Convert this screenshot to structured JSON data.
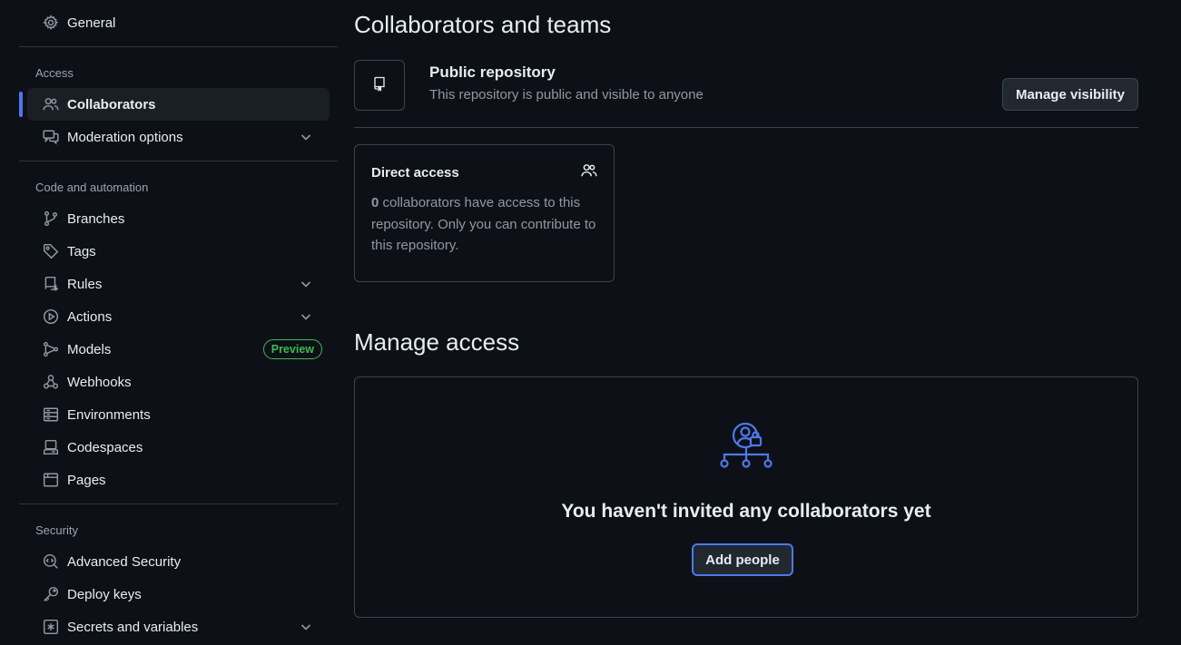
{
  "sidebar": {
    "general": "General",
    "sections": {
      "access": "Access",
      "code_automation": "Code and automation",
      "security": "Security"
    },
    "access_items": [
      {
        "label": "Collaborators",
        "icon": "people-icon",
        "active": true
      },
      {
        "label": "Moderation options",
        "icon": "comment-discussion-icon",
        "expandable": true
      }
    ],
    "code_items": [
      {
        "label": "Branches",
        "icon": "git-branch-icon"
      },
      {
        "label": "Tags",
        "icon": "tag-icon"
      },
      {
        "label": "Rules",
        "icon": "repo-push-icon",
        "expandable": true
      },
      {
        "label": "Actions",
        "icon": "play-icon",
        "expandable": true
      },
      {
        "label": "Models",
        "icon": "models-icon",
        "badge": "Preview"
      },
      {
        "label": "Webhooks",
        "icon": "webhook-icon"
      },
      {
        "label": "Environments",
        "icon": "server-icon"
      },
      {
        "label": "Codespaces",
        "icon": "codespaces-icon"
      },
      {
        "label": "Pages",
        "icon": "browser-icon"
      }
    ],
    "security_items": [
      {
        "label": "Advanced Security",
        "icon": "codescan-icon"
      },
      {
        "label": "Deploy keys",
        "icon": "key-icon"
      },
      {
        "label": "Secrets and variables",
        "icon": "key-asterisk-icon",
        "expandable": true
      }
    ]
  },
  "main": {
    "collab_title": "Collaborators and teams",
    "public_repo": {
      "title": "Public repository",
      "description": "This repository is public and visible to anyone",
      "button": "Manage visibility"
    },
    "direct_access": {
      "title": "Direct access",
      "count": "0",
      "text": " collaborators have access to this repository. Only you can contribute to this repository."
    },
    "manage_title": "Manage access",
    "empty_state": {
      "title": "You haven't invited any collaborators yet",
      "button": "Add people"
    }
  },
  "colors": {
    "background": "#0d1117",
    "accent": "#4f78e8",
    "preview_badge": "#3fb950"
  }
}
